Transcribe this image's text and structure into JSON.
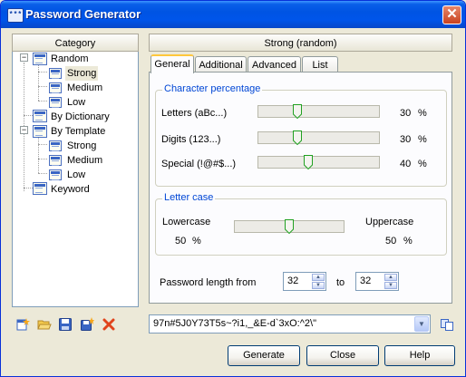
{
  "window": {
    "title": "Password Generator",
    "icon_text": "***"
  },
  "left_panel": {
    "header": "Category",
    "tree": [
      {
        "label": "Random"
      },
      {
        "label": "Strong"
      },
      {
        "label": "Medium"
      },
      {
        "label": "Low"
      },
      {
        "label": "By Dictionary"
      },
      {
        "label": "By Template"
      },
      {
        "label": "Strong"
      },
      {
        "label": "Medium"
      },
      {
        "label": "Low"
      },
      {
        "label": "Keyword"
      }
    ],
    "expanders": [
      "−",
      "−"
    ]
  },
  "right_panel": {
    "header": "Strong (random)",
    "tabs": [
      "General",
      "Additional",
      "Advanced",
      "List"
    ],
    "active_tab": "General",
    "character_percentage": {
      "title": "Character percentage",
      "rows": [
        {
          "label": "Letters (aBc...)",
          "value": "30",
          "percent_sign": "%",
          "level": 0.3
        },
        {
          "label": "Digits (123...)",
          "value": "30",
          "percent_sign": "%",
          "level": 0.3
        },
        {
          "label": "Special (!@#$...)",
          "value": "40",
          "percent_sign": "%",
          "level": 0.4
        }
      ]
    },
    "letter_case": {
      "title": "Letter case",
      "left_label": "Lowercase",
      "right_label": "Uppercase",
      "left_value": "50",
      "right_value": "50",
      "percent_sign": "%",
      "level": 0.5
    },
    "length": {
      "label_from": "Password length from",
      "from_value": "32",
      "label_to": "to",
      "to_value": "32"
    }
  },
  "password": {
    "value": "97n#5J0Y73T5s~?i1,_&E-d`3xO:^2\\\""
  },
  "toolbar": {
    "icons": [
      "new-icon",
      "open-icon",
      "save-icon",
      "save-as-icon",
      "delete-icon"
    ],
    "copy_icon": "copy-icon"
  },
  "buttons": {
    "generate": "Generate",
    "close": "Close",
    "help": "Help"
  },
  "colors": {
    "title_blue": "#0054e3",
    "group_label": "#0046d5",
    "accent_orange": "#ffc73c"
  }
}
